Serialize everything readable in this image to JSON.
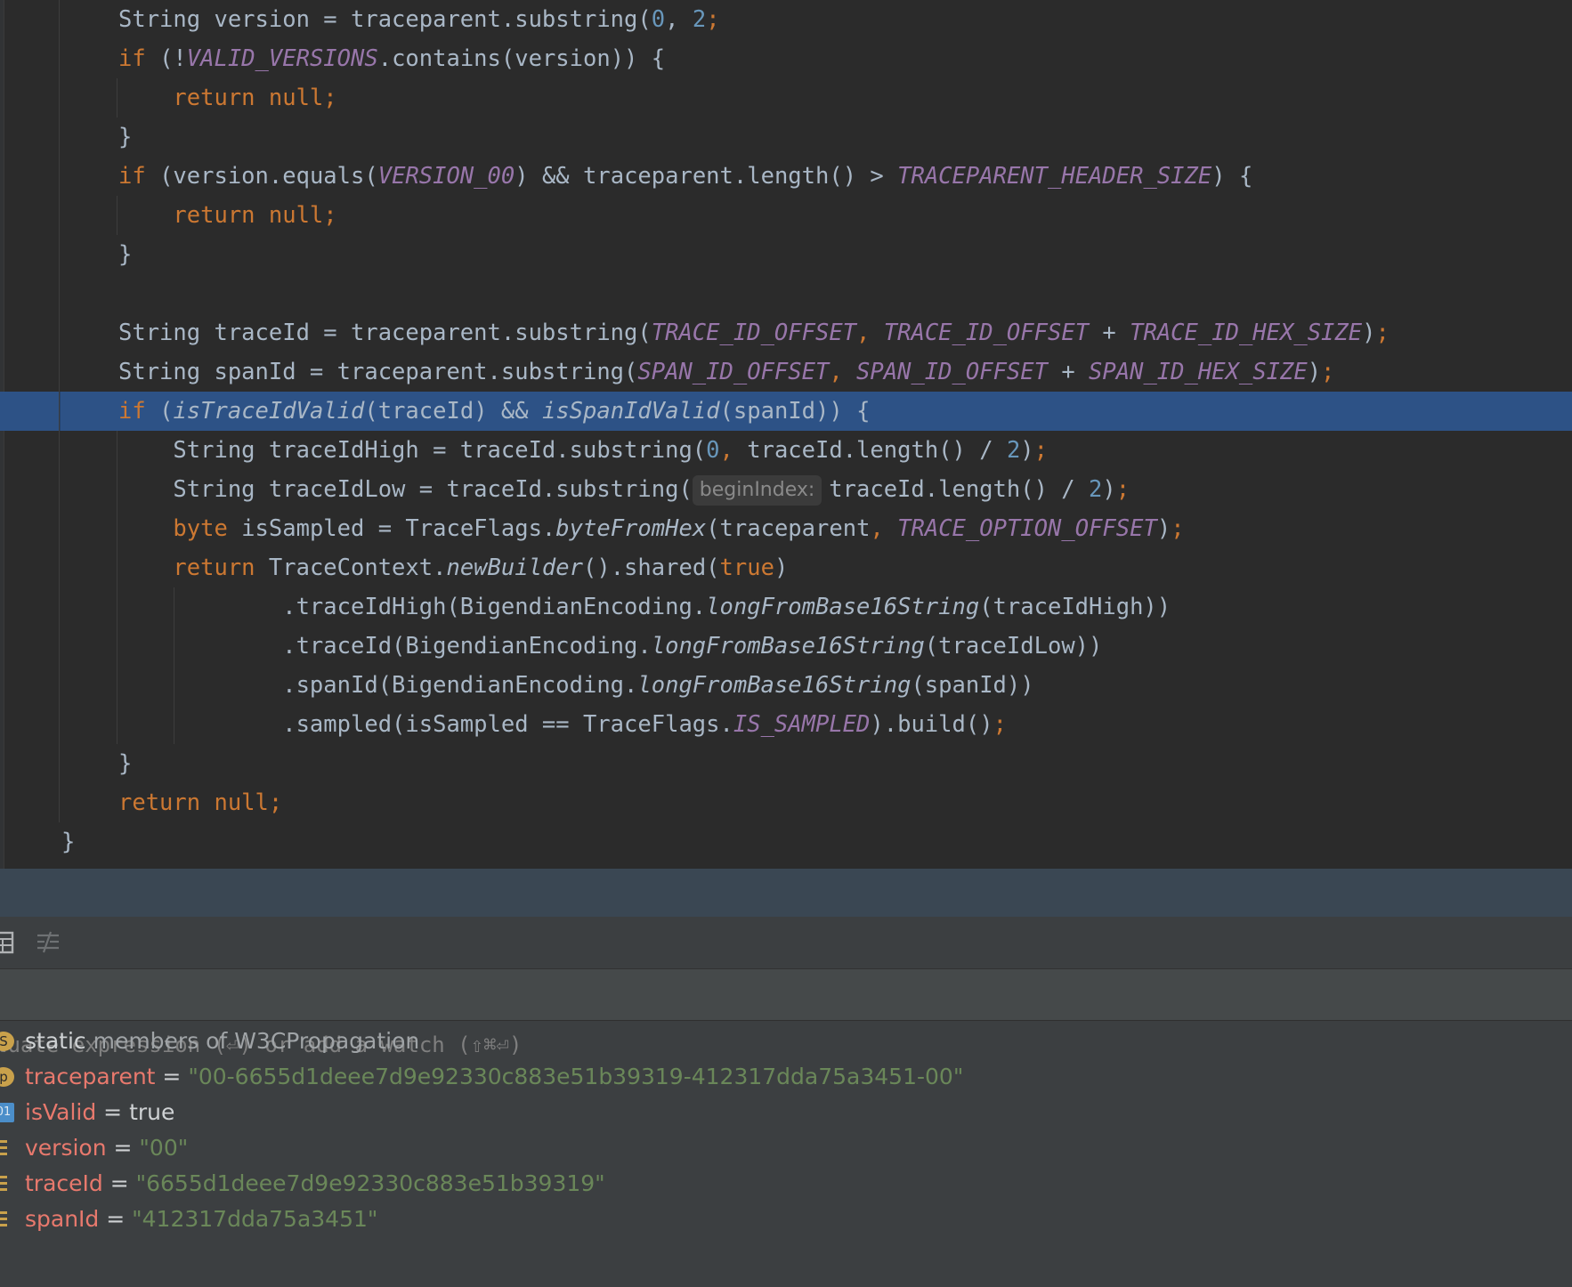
{
  "editor": {
    "lines": [
      {
        "parts": [
          [
            "",
            "String version = traceparent.substring("
          ],
          [
            "num",
            "0"
          ],
          [
            "",
            ", "
          ],
          [
            "num",
            "2"
          ],
          [
            "kw",
            ";"
          ]
        ]
      },
      {
        "parts": [
          [
            "kw",
            "if"
          ],
          [
            "",
            " (!"
          ],
          [
            "cst",
            "VALID_VERSIONS"
          ],
          [
            "",
            ".contains(version)) {"
          ]
        ]
      },
      {
        "parts": [
          [
            "kw",
            "    return null;"
          ]
        ]
      },
      {
        "parts": [
          [
            "",
            "}"
          ]
        ]
      },
      {
        "parts": [
          [
            "kw",
            "if"
          ],
          [
            "",
            " (version.equals("
          ],
          [
            "cst",
            "VERSION_00"
          ],
          [
            "",
            ") && traceparent.length() > "
          ],
          [
            "cst",
            "TRACEPARENT_HEADER_SIZE"
          ],
          [
            "",
            ") {"
          ]
        ]
      },
      {
        "parts": [
          [
            "kw",
            "    return null;"
          ]
        ]
      },
      {
        "parts": [
          [
            "",
            "}"
          ]
        ]
      },
      {
        "parts": []
      },
      {
        "parts": [
          [
            "",
            "String traceId = traceparent.substring("
          ],
          [
            "cst",
            "TRACE_ID_OFFSET"
          ],
          [
            "kw",
            ", "
          ],
          [
            "cst",
            "TRACE_ID_OFFSET"
          ],
          [
            "",
            " + "
          ],
          [
            "cst",
            "TRACE_ID_HEX_SIZE"
          ],
          [
            "",
            ")"
          ],
          [
            "kw",
            ";"
          ]
        ]
      },
      {
        "parts": [
          [
            "",
            "String spanId = traceparent.substring("
          ],
          [
            "cst",
            "SPAN_ID_OFFSET"
          ],
          [
            "kw",
            ", "
          ],
          [
            "cst",
            "SPAN_ID_OFFSET"
          ],
          [
            "",
            " + "
          ],
          [
            "cst",
            "SPAN_ID_HEX_SIZE"
          ],
          [
            "",
            ")"
          ],
          [
            "kw",
            ";"
          ]
        ]
      },
      {
        "parts": [
          [
            "kw",
            "if"
          ],
          [
            "",
            " ("
          ],
          [
            "it",
            "isTraceIdValid"
          ],
          [
            "",
            "(traceId) && "
          ],
          [
            "it",
            "isSpanIdValid"
          ],
          [
            "",
            "(spanId)) {"
          ]
        ],
        "highlight": true
      },
      {
        "parts": [
          [
            "",
            "    String traceIdHigh = traceId.substring("
          ],
          [
            "num",
            "0"
          ],
          [
            "kw",
            ", "
          ],
          [
            "",
            "traceId.length() / "
          ],
          [
            "num",
            "2"
          ],
          [
            "",
            ")"
          ],
          [
            "kw",
            ";"
          ]
        ]
      },
      {
        "parts": [
          [
            "",
            "    String traceIdLow = traceId.substring("
          ],
          [
            "hint",
            "beginIndex:"
          ],
          [
            "",
            "traceId.length() / "
          ],
          [
            "num",
            "2"
          ],
          [
            "",
            ")"
          ],
          [
            "kw",
            ";"
          ]
        ]
      },
      {
        "parts": [
          [
            "kw",
            "    byte"
          ],
          [
            "",
            " isSampled = TraceFlags."
          ],
          [
            "it",
            "byteFromHex"
          ],
          [
            "",
            "(traceparent"
          ],
          [
            "kw",
            ", "
          ],
          [
            "cst",
            "TRACE_OPTION_OFFSET"
          ],
          [
            "",
            ")"
          ],
          [
            "kw",
            ";"
          ]
        ]
      },
      {
        "parts": [
          [
            "kw",
            "    return"
          ],
          [
            "",
            " TraceContext."
          ],
          [
            "it",
            "newBuilder"
          ],
          [
            "",
            "().shared("
          ],
          [
            "kw",
            "true"
          ],
          [
            "",
            ")"
          ]
        ]
      },
      {
        "parts": [
          [
            "",
            "            .traceIdHigh(BigendianEncoding."
          ],
          [
            "it",
            "longFromBase16String"
          ],
          [
            "",
            "(traceIdHigh))"
          ]
        ]
      },
      {
        "parts": [
          [
            "",
            "            .traceId(BigendianEncoding."
          ],
          [
            "it",
            "longFromBase16String"
          ],
          [
            "",
            "(traceIdLow))"
          ]
        ]
      },
      {
        "parts": [
          [
            "",
            "            .spanId(BigendianEncoding."
          ],
          [
            "it",
            "longFromBase16String"
          ],
          [
            "",
            "(spanId))"
          ]
        ]
      },
      {
        "parts": [
          [
            "",
            "            .sampled(isSampled == TraceFlags."
          ],
          [
            "cst",
            "IS_SAMPLED"
          ],
          [
            "",
            ").build()"
          ],
          [
            "kw",
            ";"
          ]
        ]
      },
      {
        "parts": [
          [
            "",
            "}"
          ]
        ]
      },
      {
        "parts": [
          [
            "kw",
            "return null;"
          ]
        ]
      },
      {
        "parts": [
          [
            "",
            "}"
          ]
        ],
        "outdent": true
      }
    ]
  },
  "debugger": {
    "eval_placeholder": "luate expression (⏎) or add a watch (⇧⌘⏎)",
    "variables": [
      {
        "icon": "S",
        "icon_type": "circle",
        "name": "static",
        "rest": " members of W3CPropagation",
        "kind": "static"
      },
      {
        "icon": "p",
        "icon_type": "circle",
        "name": "traceparent",
        "eq": " = ",
        "value": "\"00-6655d1deee7d9e92330c883e51b39319-412317dda75a3451-00\"",
        "kind": "string"
      },
      {
        "icon": "01",
        "icon_type": "bin",
        "name": "isValid",
        "eq": " = ",
        "value": "true",
        "kind": "plain"
      },
      {
        "icon": "",
        "icon_type": "lines",
        "name": "version",
        "eq": " = ",
        "value": "\"00\"",
        "kind": "string"
      },
      {
        "icon": "",
        "icon_type": "lines",
        "name": "traceId",
        "eq": " = ",
        "value": "\"6655d1deee7d9e92330c883e51b39319\"",
        "kind": "string"
      },
      {
        "icon": "",
        "icon_type": "lines",
        "name": "spanId",
        "eq": " = ",
        "value": "\"412317dda75a3451\"",
        "kind": "string"
      }
    ]
  }
}
